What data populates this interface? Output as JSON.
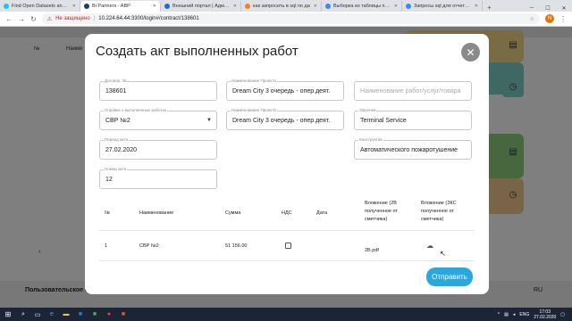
{
  "browser": {
    "tabs": [
      {
        "title": "Find Open Datasets and Ma",
        "color": "#20beff",
        "active": false
      },
      {
        "title": "Bi Partners - ABP",
        "color": "#1a3d6d",
        "active": true
      },
      {
        "title": "Внешний портал | Админка",
        "color": "#1a6fc9",
        "active": false
      },
      {
        "title": "как запросить в sql по да",
        "color": "#f48024",
        "active": false
      },
      {
        "title": "Выборка из таблицы по да",
        "color": "#4285f4",
        "active": false
      },
      {
        "title": "Запросы sql для отчетов -",
        "color": "#4285f4",
        "active": false
      }
    ],
    "security_label": "Не защищено",
    "url": "10.224.64.44:3300/login#/contract/138601",
    "profile_initial": "N"
  },
  "app": {
    "col_num": "№",
    "col_name": "Наиме",
    "footer_left": "Пользовательское со",
    "footer_right": "RU",
    "side_colors": {
      "yellow": "#f3d98a",
      "teal": "#7fd1c9",
      "green": "#8fcf7e",
      "orange": "#f2c98f"
    }
  },
  "modal": {
    "title": "Создать акт выполненных работ",
    "fields": {
      "contract": {
        "label": "Договор, №",
        "value": "138601"
      },
      "project1": {
        "label": "Наименование Проекта",
        "value": "Dream City 3 очередь - опер.деят."
      },
      "works": {
        "label": "",
        "placeholder": "Наименование работ/услуг/товара"
      },
      "certificate": {
        "label": "Справка о выполненных работах",
        "value": "СВР №2"
      },
      "project2": {
        "label": "Наименование Проекта",
        "value": "Dream City 3 очередь - опер.деят."
      },
      "customer": {
        "label": "Заказчик",
        "value": "Terminal Service"
      },
      "period": {
        "label": "Период акта",
        "value": "27.02.2020"
      },
      "construction": {
        "label": "Конструктив",
        "value": "Автоматического пожаротушение"
      },
      "act_number": {
        "label": "Номер акта",
        "value": "12"
      }
    },
    "table": {
      "headers": {
        "num": "№",
        "name": "Наименование",
        "sum": "Сумма",
        "vat": "НДС",
        "date": "Дата",
        "att2": [
          "Вложение (2В",
          "полученное от",
          "сметчика)"
        ],
        "att3": [
          "Вложение (ЗКС",
          "полученное от",
          "сметчика)"
        ]
      },
      "rows": [
        {
          "num": "1",
          "name": "СВР №2",
          "sum": "51 156.00",
          "vat_checked": false,
          "date": "",
          "att2": "2B.pdf",
          "att3_icon": "cloud-upload-icon"
        }
      ]
    },
    "submit_label": "Отправить"
  },
  "taskbar": {
    "lang": "ENG",
    "time": "17:03",
    "date": "27.02.2020"
  }
}
